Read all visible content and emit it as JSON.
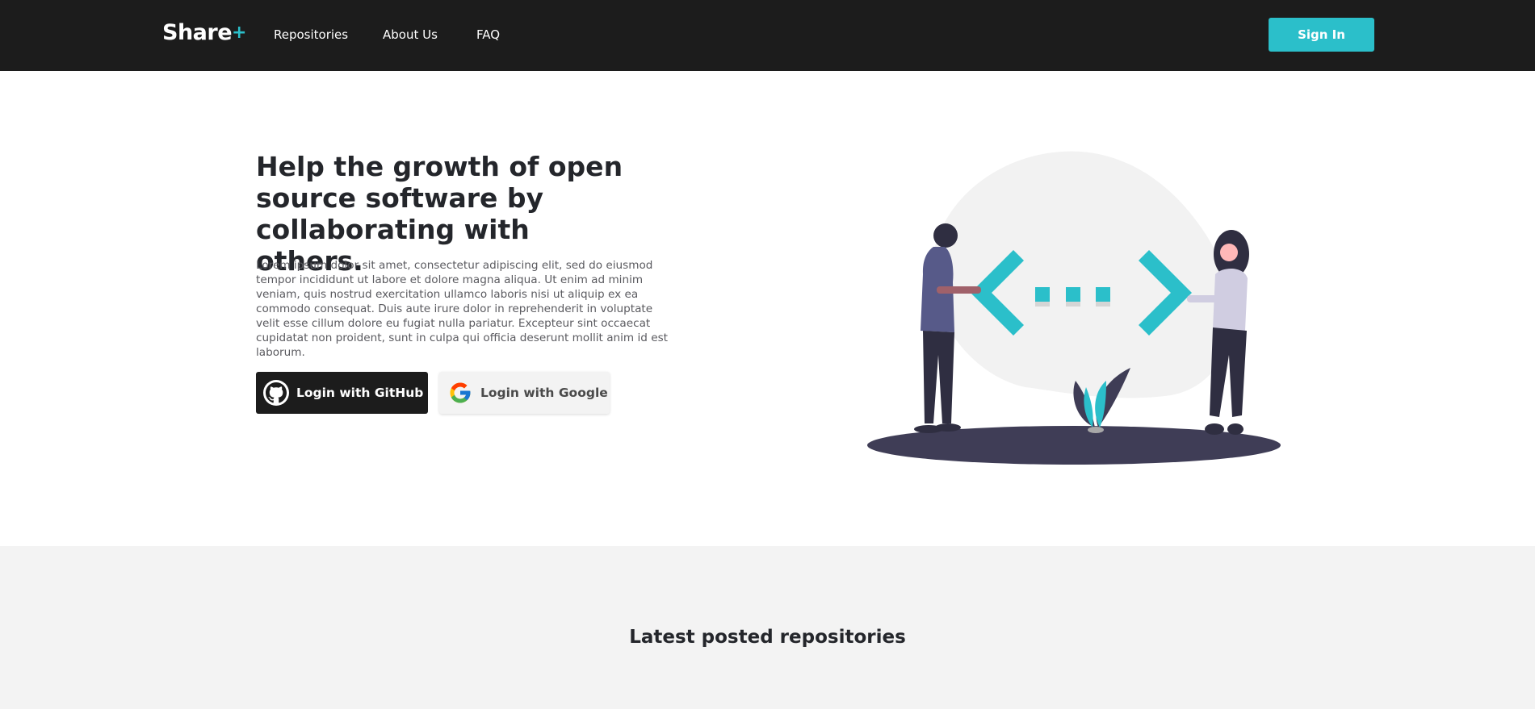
{
  "nav": {
    "brand": "Share",
    "brand_plus": "+",
    "links": [
      "Repositories",
      "About Us",
      "FAQ"
    ],
    "signin_label": "Sign In"
  },
  "hero": {
    "title": "Help the growth of open source software by collaborating with others.",
    "text": "Lorem ipsum dolor sit amet, consectetur adipiscing elit, sed do eiusmod tempor incididunt ut labore et dolore magna aliqua. Ut enim ad minim veniam, quis nostrud exercitation ullamco laboris nisi ut aliquip ex ea commodo consequat. Duis aute irure dolor in reprehenderit in voluptate velit esse cillum dolore eu fugiat nulla pariatur. Excepteur sint occaecat cupidatat non proident, sunt in culpa qui officia deserunt mollit anim id est laborum.",
    "github_label": "Login with GitHub",
    "google_label": "Login with Google"
  },
  "section": {
    "title": "Latest posted repositories"
  },
  "colors": {
    "accent": "#2bbfca",
    "navbar": "#1c1c1c",
    "section_bg": "#f3f3f3"
  },
  "icons": {
    "github": "github-icon",
    "google": "google-icon"
  }
}
